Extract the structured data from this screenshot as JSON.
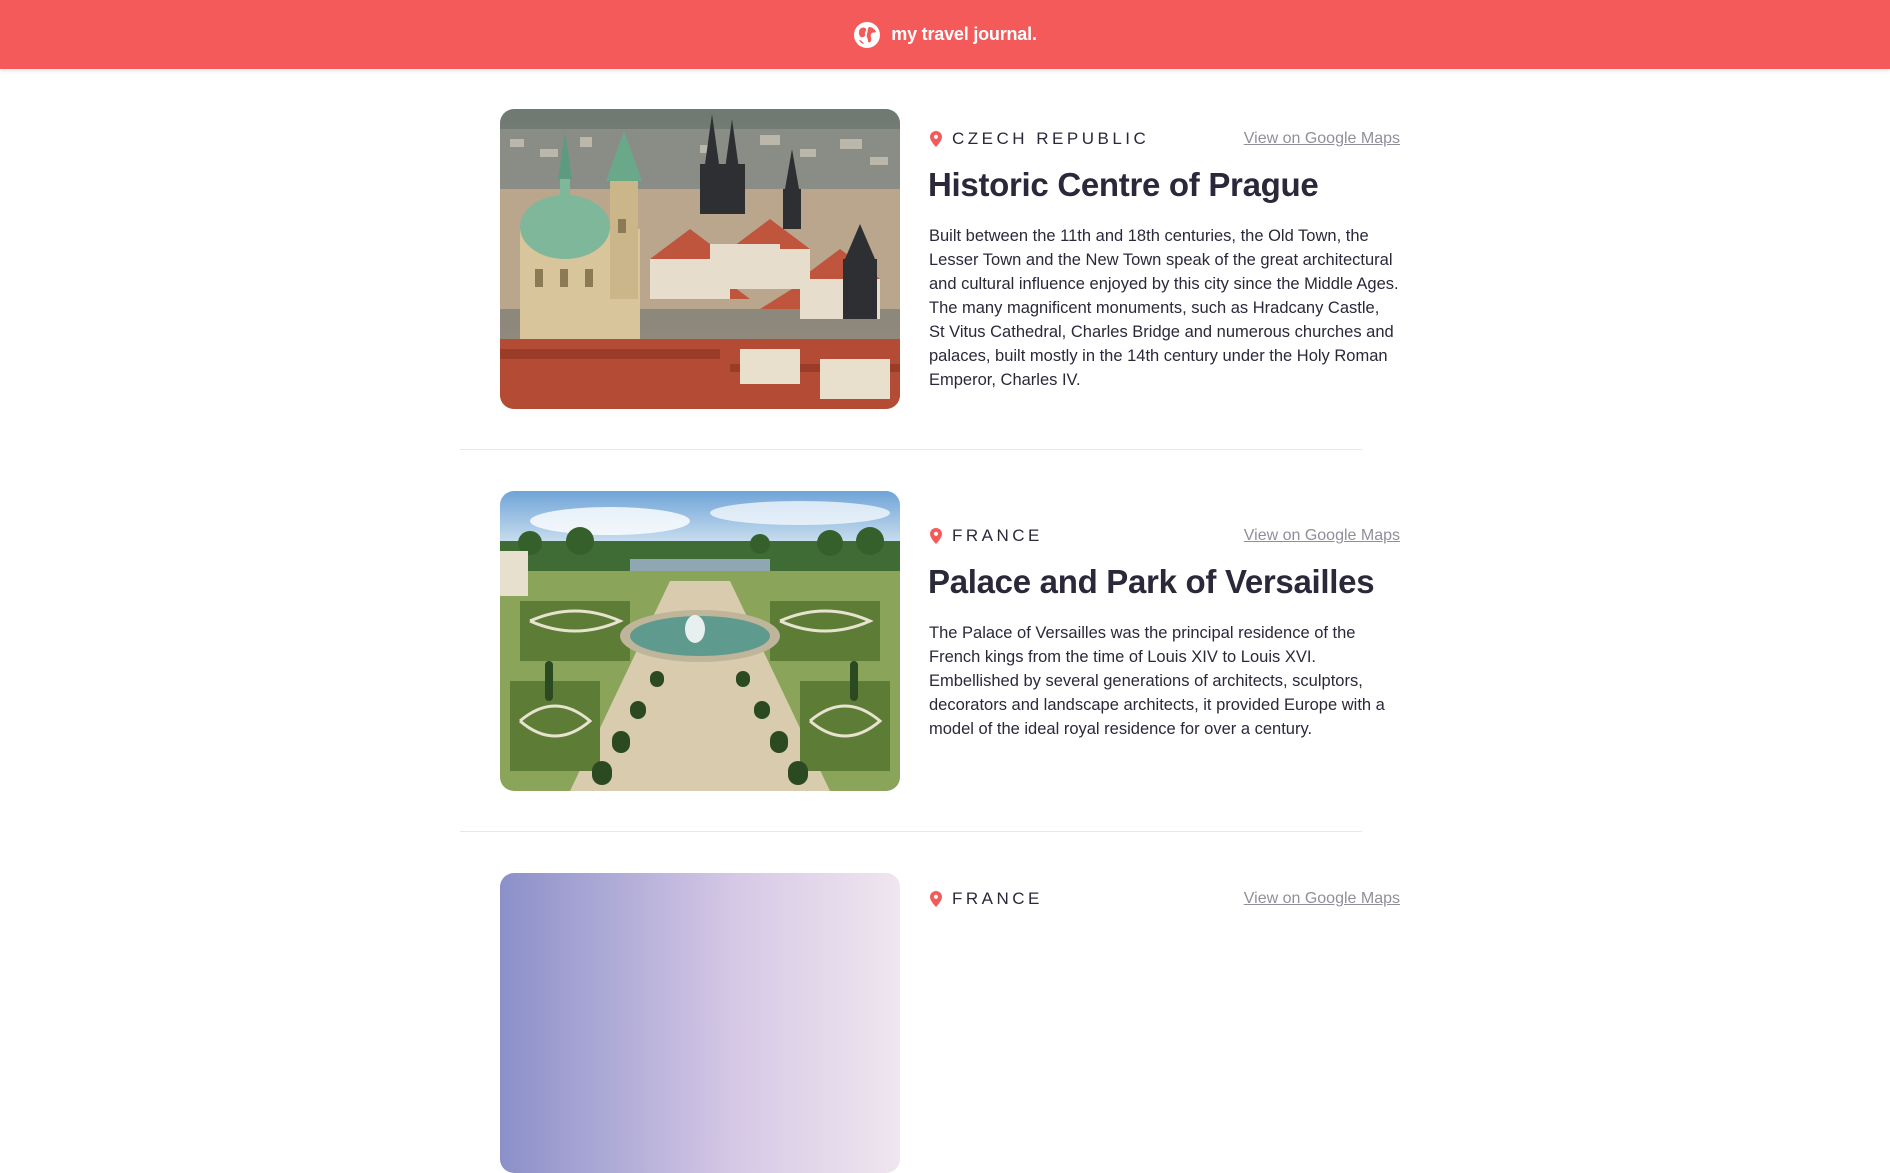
{
  "header": {
    "title": "my travel journal.",
    "icon": "globe-icon"
  },
  "entries": [
    {
      "country": "CZECH REPUBLIC",
      "maps_link": "View on Google Maps",
      "title": "Historic Centre of Prague",
      "description": "Built between the 11th and 18th centuries, the Old Town, the Lesser Town and the New Town speak of the great architectural and cultural influence enjoyed by this city since the Middle Ages. The many magnificent monuments, such as Hradcany Castle, St Vitus Cathedral, Charles Bridge and numerous churches and palaces, built mostly in the 14th century under the Holy Roman Emperor, Charles IV."
    },
    {
      "country": "FRANCE",
      "maps_link": "View on Google Maps",
      "title": "Palace and Park of Versailles",
      "description": "The Palace of Versailles was the principal residence of the French kings from the time of Louis XIV to Louis XVI. Embellished by several generations of architects, sculptors, decorators and landscape architects, it provided Europe with a model of the ideal royal residence for over a century."
    },
    {
      "country": "FRANCE",
      "maps_link": "View on Google Maps",
      "title": "",
      "description": ""
    }
  ],
  "colors": {
    "header_bg": "#f55a5a",
    "pin": "#f55a5a",
    "text": "#2b283a",
    "link": "#918e9b",
    "divider": "#e8e8e8"
  }
}
